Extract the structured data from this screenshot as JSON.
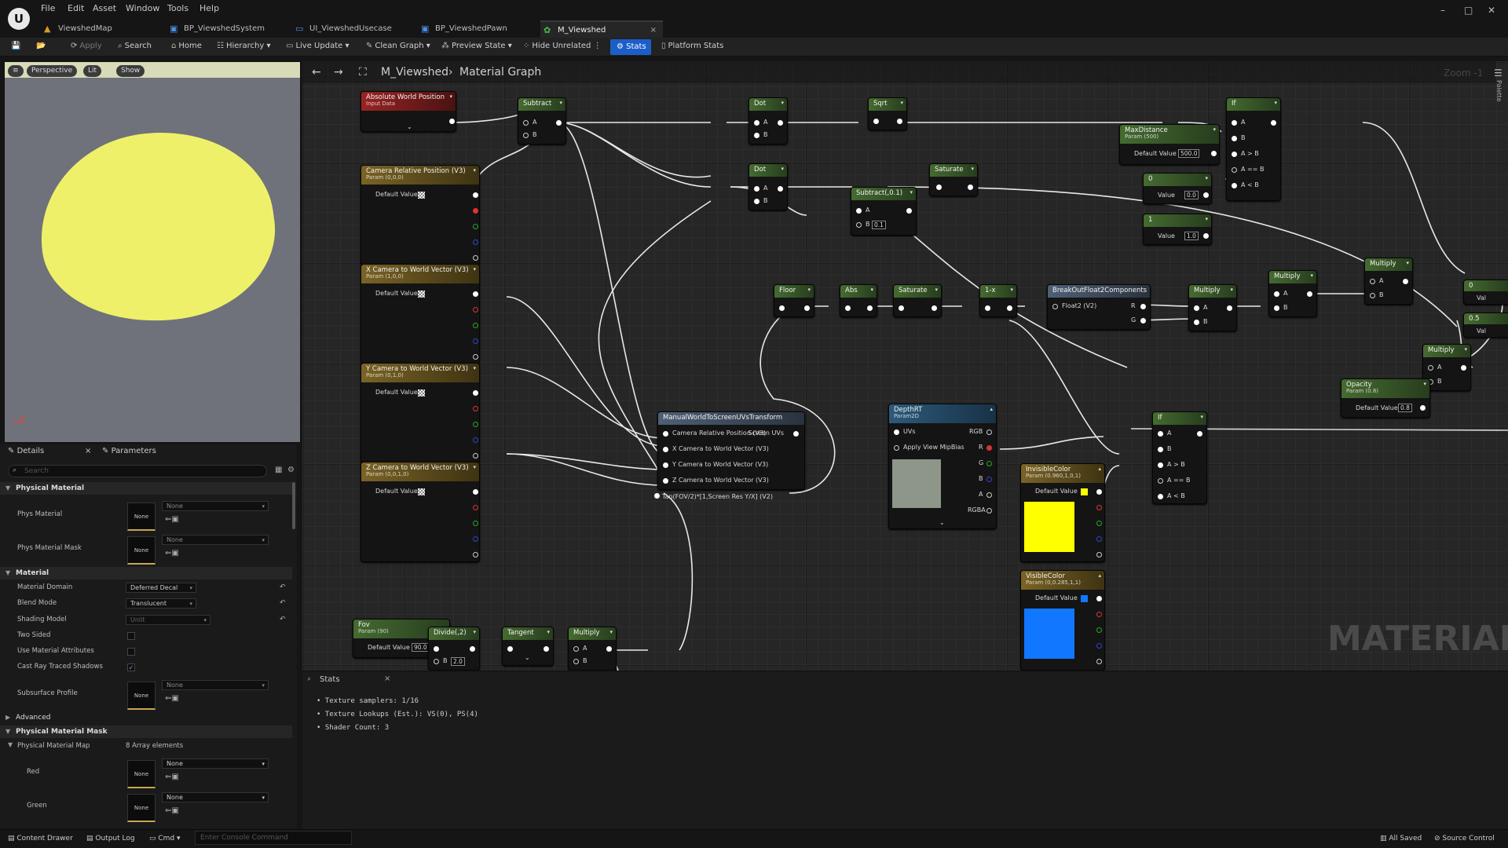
{
  "titlebar": {
    "logo": "U",
    "menus": [
      "File",
      "Edit",
      "Asset",
      "Window",
      "Tools",
      "Help"
    ],
    "tabs": [
      {
        "label": "ViewshedMap",
        "icon": "map-icon"
      },
      {
        "label": "BP_ViewshedSystem",
        "icon": "blueprint-icon"
      },
      {
        "label": "UI_ViewshedUsecase",
        "icon": "widget-icon"
      },
      {
        "label": "BP_ViewshedPawn",
        "icon": "blueprint-icon"
      },
      {
        "label": "M_Viewshed",
        "icon": "material-icon",
        "close": "×"
      }
    ],
    "win": {
      "min": "–",
      "max": "□",
      "close": "✕"
    }
  },
  "toolbar": {
    "save": "💾",
    "browse": "📂",
    "apply": "Apply",
    "search": "Search",
    "home": "Home",
    "hierarchy": "Hierarchy",
    "live_update": "Live Update",
    "clean_graph": "Clean Graph",
    "preview_state": "Preview State",
    "hide_unrelated": "Hide Unrelated",
    "stats": "Stats",
    "platform_stats": "Platform Stats"
  },
  "viewport": {
    "menu": "≡",
    "perspective": "Perspective",
    "lit": "Lit",
    "show": "Show",
    "axes": "↘Z"
  },
  "details": {
    "tab_details": "Details",
    "tab_details_close": "×",
    "tab_parameters": "Parameters",
    "search_placeholder": "Search",
    "sections": {
      "phys": "Physical Material",
      "material": "Material",
      "advanced": "Advanced",
      "pmm": "Physical Material Mask"
    },
    "rows": {
      "phys_material": "Phys Material",
      "phys_material_mask": "Phys Material Mask",
      "material_domain": "Material Domain",
      "material_domain_val": "Deferred Decal",
      "blend_mode": "Blend Mode",
      "blend_mode_val": "Translucent",
      "shading_model": "Shading Model",
      "shading_model_val": "Unlit",
      "two_sided": "Two Sided",
      "use_attrs": "Use Material Attributes",
      "cast_rt": "Cast Ray Traced Shadows",
      "cast_rt_check": "✓",
      "subsurface": "Subsurface Profile",
      "pmm_map": "Physical Material Map",
      "pmm_count": "8 Array elements",
      "red": "Red",
      "green": "Green"
    },
    "none": "None"
  },
  "graph": {
    "breadcrumb_title": "M_Viewshed",
    "breadcrumb_sep": "›",
    "breadcrumb_graph": "Material Graph",
    "back": "←",
    "forward": "→",
    "zoom": "Zoom -1",
    "watermark": "MATERIAL",
    "palette": "Palette"
  },
  "nodes": {
    "awp": {
      "title": "Absolute World Position",
      "sub": "Input Data"
    },
    "crp": {
      "title": "Camera Relative Position (V3)",
      "sub": "Param (0,0,0)",
      "dv": "Default Value"
    },
    "xcw": {
      "title": "X Camera to World Vector (V3)",
      "sub": "Param (1,0,0)",
      "dv": "Default Value"
    },
    "ycw": {
      "title": "Y Camera to World Vector (V3)",
      "sub": "Param (0,1,0)",
      "dv": "Default Value"
    },
    "zcw": {
      "title": "Z Camera to World Vector (V3)",
      "sub": "Param (0,0,1,0)",
      "dv": "Default Value"
    },
    "fov": {
      "title": "Fov",
      "sub": "Param (90)",
      "dv": "Default Value",
      "val": "90.0"
    },
    "subtract": {
      "title": "Subtract",
      "a": "A",
      "b": "B"
    },
    "dot1": {
      "title": "Dot",
      "a": "A",
      "b": "B"
    },
    "dot2": {
      "title": "Dot",
      "a": "A",
      "b": "B"
    },
    "sqrt": {
      "title": "Sqrt"
    },
    "saturate1": {
      "title": "Saturate"
    },
    "sub01": {
      "title": "Subtract(,0.1)",
      "a": "A",
      "b": "B",
      "bval": "0.1"
    },
    "if1": {
      "title": "If",
      "a": "A",
      "b": "B",
      "agb": "A > B",
      "aeb": "A == B",
      "alb": "A < B"
    },
    "maxdist": {
      "title": "MaxDistance",
      "sub": "Param (500)",
      "dv": "Default Value",
      "val": "500.0"
    },
    "c0": {
      "title": "0",
      "lbl": "Value",
      "val": "0.0"
    },
    "c1": {
      "title": "1",
      "lbl": "Value",
      "val": "1.0"
    },
    "floor": {
      "title": "Floor"
    },
    "abs": {
      "title": "Abs"
    },
    "saturate2": {
      "title": "Saturate"
    },
    "onex": {
      "title": "1-x"
    },
    "bof2": {
      "title": "BreakOutFloat2Components",
      "in": "Float2 (V2)",
      "r": "R",
      "g": "G"
    },
    "mul1": {
      "title": "Multiply",
      "a": "A",
      "b": "B"
    },
    "mul2": {
      "title": "Multiply",
      "a": "A",
      "b": "B"
    },
    "mul3": {
      "title": "Multiply",
      "a": "A",
      "b": "B"
    },
    "mul4": {
      "title": "Multiply",
      "a": "A",
      "b": "B"
    },
    "mw": {
      "title": "ManualWorldToScreenUVsTransform",
      "out": "Screen UVs",
      "i1": "Camera Relative Position (V3)",
      "i2": "X Camera to World Vector (V3)",
      "i3": "Y Camera to World Vector (V3)",
      "i4": "Z Camera to World Vector (V3)",
      "i5": "Tan(FOV/2)*[1,Screen Res Y/X] (V2)"
    },
    "depth": {
      "title": "DepthRT",
      "sub": "Param2D",
      "uvs": "UVs",
      "mip": "Apply View MipBias",
      "rgb": "RGB",
      "r": "R",
      "g": "G",
      "b": "B",
      "a": "A",
      "rgba": "RGBA"
    },
    "if2": {
      "title": "If",
      "a": "A",
      "b": "B",
      "agb": "A > B",
      "aeb": "A == B",
      "alb": "A < B"
    },
    "invis": {
      "title": "InvisibleColor",
      "sub": "Param (0.960,1,0,1)",
      "dv": "Default Value",
      "color": "#ffff00"
    },
    "vis": {
      "title": "VisibleColor",
      "sub": "Param (0,0.285,1,1)",
      "dv": "Default Value",
      "color": "#1177ff"
    },
    "opacity": {
      "title": "Opacity",
      "sub": "Param (0.8)",
      "dv": "Default Value",
      "val": "0.8"
    },
    "divide": {
      "title": "Divide(,2)",
      "b": "B",
      "bval": "2.0"
    },
    "tangent": {
      "title": "Tangent"
    },
    "mulf": {
      "title": "Multiply",
      "a": "A",
      "b": "B"
    },
    "edge1": {
      "val": "0"
    },
    "edge2": {
      "val": "0.5"
    },
    "edge_lbl": "Val"
  },
  "stats": {
    "title": "Stats",
    "close": "×",
    "lines": [
      "Texture samplers: 1/16",
      "Texture Lookups (Est.): VS(0), PS(4)",
      "Shader Count: 3"
    ]
  },
  "statusbar": {
    "content_drawer": "Content Drawer",
    "output_log": "Output Log",
    "cmd": "Cmd",
    "console_placeholder": "Enter Console Command",
    "all_saved": "All Saved",
    "source_control": "Source Control"
  }
}
